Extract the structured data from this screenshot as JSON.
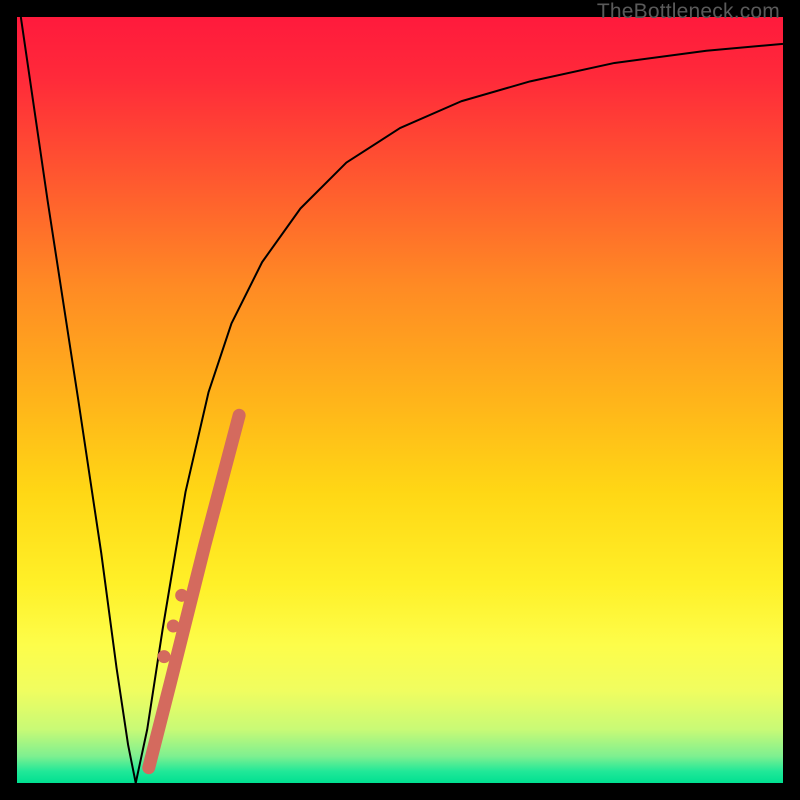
{
  "watermark": "TheBottleneck.com",
  "chart_data": {
    "type": "line",
    "title": "",
    "xlabel": "",
    "ylabel": "",
    "xlim": [
      0,
      100
    ],
    "ylim": [
      0,
      100
    ],
    "grid": false,
    "legend": false,
    "gradient_stops": [
      {
        "offset": 0.0,
        "color": "#ff1a3c"
      },
      {
        "offset": 0.08,
        "color": "#ff2a3a"
      },
      {
        "offset": 0.2,
        "color": "#ff5430"
      },
      {
        "offset": 0.35,
        "color": "#ff8a24"
      },
      {
        "offset": 0.5,
        "color": "#ffb41a"
      },
      {
        "offset": 0.62,
        "color": "#ffd715"
      },
      {
        "offset": 0.74,
        "color": "#fff028"
      },
      {
        "offset": 0.82,
        "color": "#fdfd4a"
      },
      {
        "offset": 0.88,
        "color": "#f0fd60"
      },
      {
        "offset": 0.93,
        "color": "#c8fa76"
      },
      {
        "offset": 0.965,
        "color": "#7ef090"
      },
      {
        "offset": 0.985,
        "color": "#20e898"
      },
      {
        "offset": 1.0,
        "color": "#00e091"
      }
    ],
    "series": [
      {
        "name": "bottleneck-curve-left",
        "stroke": "#000000",
        "stroke_width": 2,
        "x": [
          0.5,
          4,
          8,
          11,
          13,
          14.5,
          15.5
        ],
        "y": [
          100,
          76,
          50,
          30,
          15,
          5,
          0
        ]
      },
      {
        "name": "bottleneck-curve-right",
        "stroke": "#000000",
        "stroke_width": 2,
        "x": [
          15.5,
          17,
          19,
          22,
          25,
          28,
          32,
          37,
          43,
          50,
          58,
          67,
          78,
          90,
          100
        ],
        "y": [
          0,
          7,
          20,
          38,
          51,
          60,
          68,
          75,
          81,
          85.5,
          89,
          91.6,
          94,
          95.6,
          96.5
        ]
      },
      {
        "name": "highlight-band",
        "stroke": "#d46a5e",
        "stroke_width": 13,
        "linecap": "round",
        "x": [
          17.2,
          20.0,
          24.5,
          29.0
        ],
        "y": [
          2.0,
          13.0,
          31.0,
          48.0
        ]
      },
      {
        "name": "highlight-dots",
        "type": "scatter",
        "color": "#d46a5e",
        "radius": 6.5,
        "x": [
          19.2,
          20.4,
          21.5
        ],
        "y": [
          16.5,
          20.5,
          24.5
        ]
      }
    ]
  }
}
